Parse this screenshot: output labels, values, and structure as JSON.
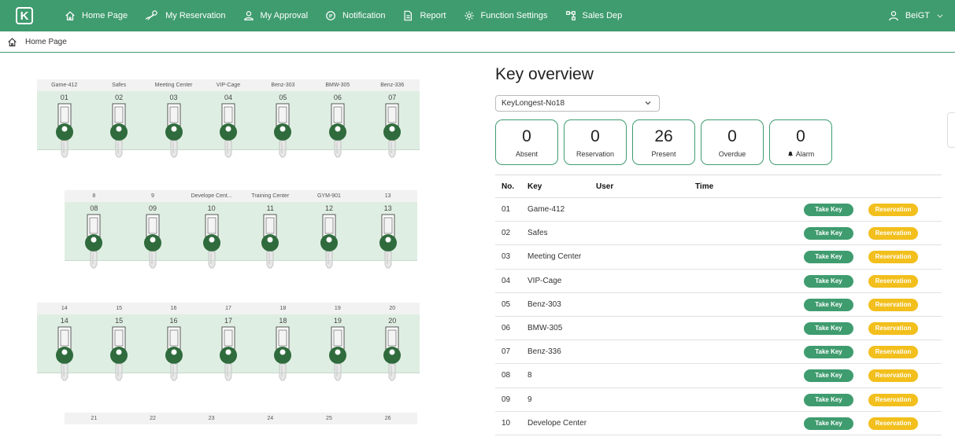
{
  "app": {
    "logo_letter": "K"
  },
  "nav": {
    "items": [
      {
        "label": "Home Page",
        "icon": "home-icon"
      },
      {
        "label": "My Reservation",
        "icon": "key-reservation-icon"
      },
      {
        "label": "My Approval",
        "icon": "user-approval-icon"
      },
      {
        "label": "Notification",
        "icon": "chat-icon"
      },
      {
        "label": "Report",
        "icon": "document-icon"
      },
      {
        "label": "Function Settings",
        "icon": "gear-icon"
      },
      {
        "label": "Sales Dep",
        "icon": "org-chart-icon"
      }
    ],
    "user": "BeiGT"
  },
  "breadcrumb": {
    "label": "Home Page"
  },
  "cabinet": {
    "panels": [
      {
        "labels": [
          "Game-412",
          "Safes",
          "Meeting Center",
          "VIP-Cage",
          "Benz-303",
          "BMW-305",
          "Benz-336"
        ],
        "slots": [
          "01",
          "02",
          "03",
          "04",
          "05",
          "06",
          "07"
        ]
      },
      {
        "labels": [
          "8",
          "9",
          "Develope Cent...",
          "Training Center",
          "GYM-901",
          "13"
        ],
        "slots": [
          "08",
          "09",
          "10",
          "11",
          "12",
          "13"
        ]
      },
      {
        "labels": [
          "14",
          "15",
          "16",
          "17",
          "18",
          "19",
          "20"
        ],
        "slots": [
          "14",
          "15",
          "16",
          "17",
          "18",
          "19",
          "20"
        ]
      },
      {
        "labels": [
          "21",
          "22",
          "23",
          "24",
          "25",
          "26"
        ],
        "slots": []
      }
    ]
  },
  "overview": {
    "title": "Key overview",
    "cabinet_select": "KeyLongest-No18",
    "stats": [
      {
        "value": "0",
        "label": "Absent"
      },
      {
        "value": "0",
        "label": "Reservation"
      },
      {
        "value": "26",
        "label": "Present"
      },
      {
        "value": "0",
        "label": "Overdue"
      },
      {
        "value": "0",
        "label": "Alarm",
        "icon": "bell-icon"
      }
    ],
    "table": {
      "headers": {
        "no": "No.",
        "key": "Key",
        "user": "User",
        "time": "Time"
      },
      "take_label": "Take Key",
      "reserve_label": "Reservation",
      "rows": [
        {
          "no": "01",
          "key": "Game-412"
        },
        {
          "no": "02",
          "key": "Safes"
        },
        {
          "no": "03",
          "key": "Meeting Center"
        },
        {
          "no": "04",
          "key": "VIP-Cage"
        },
        {
          "no": "05",
          "key": "Benz-303"
        },
        {
          "no": "06",
          "key": "BMW-305"
        },
        {
          "no": "07",
          "key": "Benz-336"
        },
        {
          "no": "08",
          "key": "8"
        },
        {
          "no": "09",
          "key": "9"
        },
        {
          "no": "10",
          "key": "Develope Center"
        }
      ]
    }
  },
  "colors": {
    "brand": "#3f9c6f",
    "key_green": "#2f6b3c",
    "reserve": "#f2bf1c",
    "bay": "#dfeee3"
  }
}
